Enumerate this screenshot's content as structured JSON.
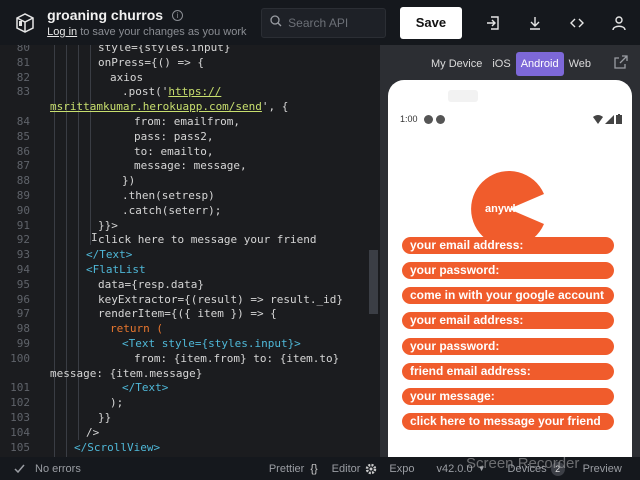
{
  "header": {
    "project_title": "groaning churros",
    "subtitle_login": "Log in",
    "subtitle_rest": " to save your changes as you work",
    "search_placeholder": "Search API",
    "save_label": "Save"
  },
  "editor": {
    "lines": [
      {
        "n": "80",
        "code": "style={styles.input}"
      },
      {
        "n": "81",
        "code": "onPress={() => {"
      },
      {
        "n": "82",
        "code": "axios"
      },
      {
        "n": "83",
        "code": ".post('"
      },
      {
        "n": "",
        "code": "msrittamkumar.herokuapp.com/send"
      },
      {
        "n": "84",
        "code": "from: emailfrom,"
      },
      {
        "n": "85",
        "code": "pass: pass2,"
      },
      {
        "n": "86",
        "code": "to: emailto,"
      },
      {
        "n": "87",
        "code": "message: message,"
      },
      {
        "n": "88",
        "code": "})"
      },
      {
        "n": "89",
        "code": ".then(setresp)"
      },
      {
        "n": "90",
        "code": ".catch(seterr);"
      },
      {
        "n": "91",
        "code": "}}>"
      },
      {
        "n": "92",
        "code": "click here to message your friend"
      },
      {
        "n": "93",
        "code": "</Text>"
      },
      {
        "n": "94",
        "code": "<FlatList"
      },
      {
        "n": "95",
        "code": "data={resp.data}"
      },
      {
        "n": "96",
        "code": "keyExtractor={(result) => result._id}"
      },
      {
        "n": "97",
        "code": "renderItem={({ item }) => {"
      },
      {
        "n": "98",
        "code": "return ("
      },
      {
        "n": "99",
        "code": "<Text style={styles.input}>"
      },
      {
        "n": "100",
        "code": "from: {item.from} to: {item.to}"
      },
      {
        "n": "",
        "code": "message: {item.message}"
      },
      {
        "n": "101",
        "code": "</Text>"
      },
      {
        "n": "102",
        "code": ");"
      },
      {
        "n": "103",
        "code": "}}"
      },
      {
        "n": "104",
        "code": "/>"
      },
      {
        "n": "105",
        "code": "</ScrollView>"
      }
    ],
    "url_prefix": "https://",
    "url_suffix": "', {"
  },
  "preview": {
    "tabs": [
      "My Device",
      "iOS",
      "Android",
      "Web"
    ],
    "active_tab": "Android",
    "status_time": "1:00",
    "logo_text": "anywhere",
    "items": [
      "your email address:",
      "your password:",
      "come in with your google account",
      "your email address:",
      "your password:",
      "friend email address:",
      "your message:",
      "click here to message your friend"
    ]
  },
  "footer": {
    "errors": "No errors",
    "prettier": "Prettier",
    "editor": "Editor",
    "expo": "Expo",
    "version": "v42.0.0",
    "devices": "Devices",
    "devices_count": "2",
    "preview": "Preview",
    "watermark": "Screen Recorder"
  },
  "colors": {
    "accent": "#7d68d8",
    "brand_orange": "#f05c2c"
  }
}
